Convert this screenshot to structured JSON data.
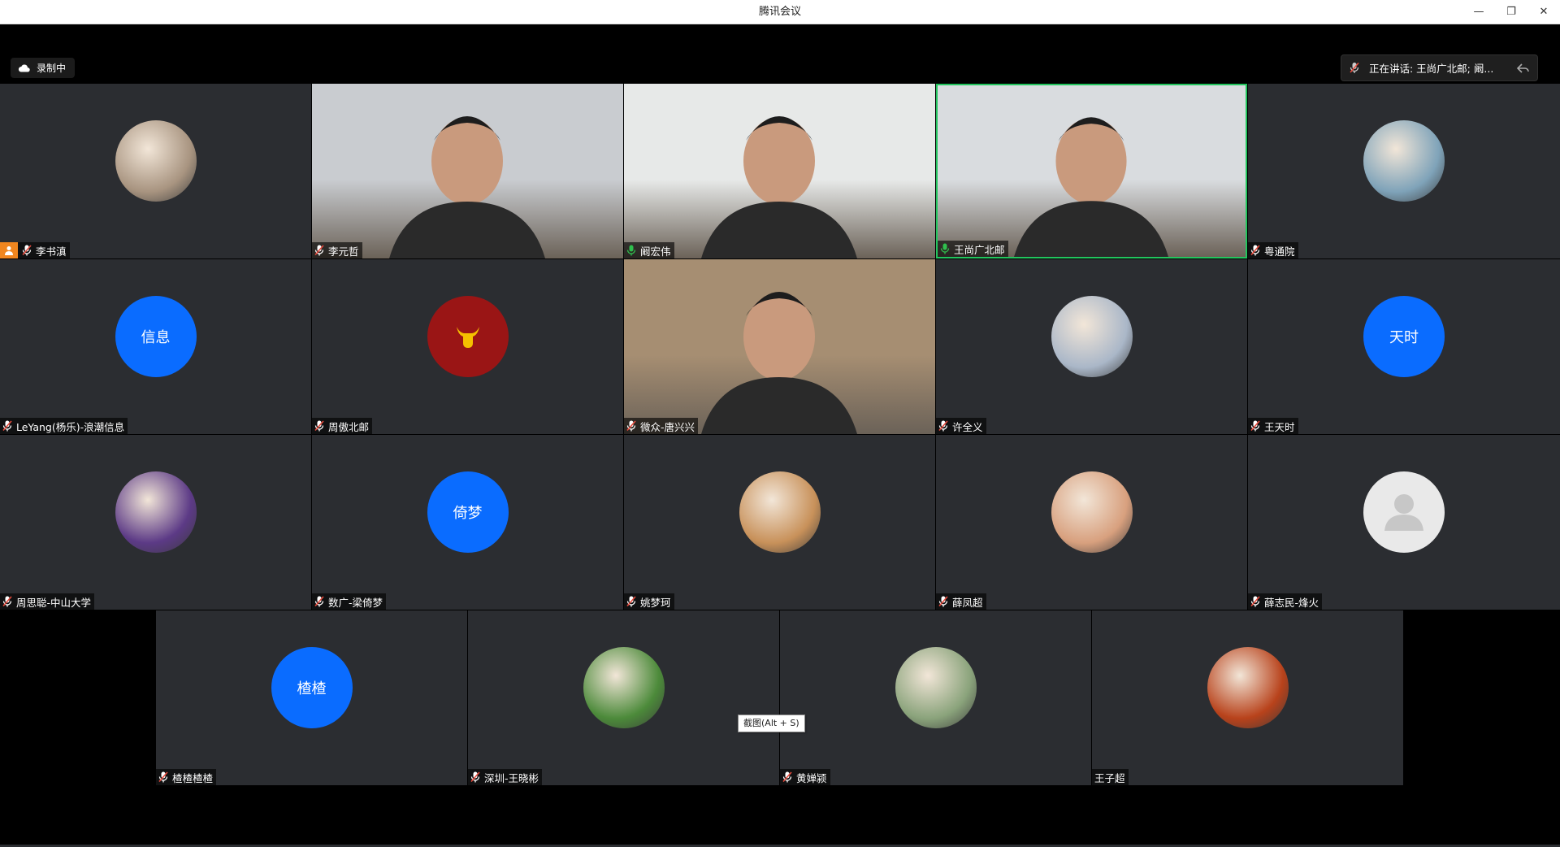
{
  "window": {
    "title": "腾讯会议",
    "minimize": "—",
    "restore": "❐",
    "close": "✕"
  },
  "recording": {
    "label": "录制中",
    "icon": "cloud-icon"
  },
  "speaking": {
    "label": "正在讲话: 王尚广北邮; 阚..."
  },
  "tooltip": "截图(Alt + S)",
  "colors": {
    "tile_bg": "#2b2d31",
    "accent_blue": "#0a6cff",
    "active_green": "#22c55e",
    "host_orange": "#f0861f",
    "mic_red": "#e64a3c",
    "mic_green": "#2fbf4d"
  },
  "participants": [
    {
      "name": "李书滇",
      "host": true,
      "type": "photo",
      "mic": "muted",
      "bg": "#a89480"
    },
    {
      "name": "李元哲",
      "type": "video",
      "mic": "muted",
      "bg": "#c9ccd0"
    },
    {
      "name": "阚宏伟",
      "type": "video",
      "mic": "speaking",
      "bg": "#e7e9e8"
    },
    {
      "name": "王尚广北邮",
      "type": "video",
      "mic": "speaking",
      "active": true,
      "bg": "#d9dcdf"
    },
    {
      "name": "粤通院",
      "type": "photo",
      "mic": "muted",
      "bg": "#7fa3b9"
    },
    {
      "name": "LeYang(杨乐)-浪潮信息",
      "type": "initials",
      "initials": "信息",
      "mic": "muted",
      "bg": "#0a6cff"
    },
    {
      "name": "周傲北邮",
      "type": "photo",
      "mic": "muted",
      "bg": "#9a1515",
      "icon": "ox-icon"
    },
    {
      "name": "微众-唐兴兴",
      "type": "video",
      "mic": "muted",
      "bg": "#a68e72"
    },
    {
      "name": "许全义",
      "type": "photo",
      "mic": "muted",
      "bg": "#aab7c8"
    },
    {
      "name": "王天时",
      "type": "initials",
      "initials": "天时",
      "mic": "muted",
      "bg": "#0a6cff"
    },
    {
      "name": "周思聪-中山大学",
      "type": "photo",
      "mic": "muted",
      "bg": "#5c3a86"
    },
    {
      "name": "数广-梁倚梦",
      "type": "initials",
      "initials": "倚梦",
      "mic": "muted",
      "bg": "#0a6cff"
    },
    {
      "name": "姚梦珂",
      "type": "photo",
      "mic": "muted",
      "bg": "#c8915a"
    },
    {
      "name": "薛凤超",
      "type": "photo",
      "mic": "muted",
      "bg": "#d8a07e"
    },
    {
      "name": "薛志民-烽火",
      "type": "default",
      "mic": "muted",
      "bg": "#e9e9e9",
      "icon": "user-icon"
    },
    {
      "name": "楂楂楂楂",
      "type": "initials",
      "initials": "楂楂",
      "mic": "muted",
      "bg": "#0a6cff"
    },
    {
      "name": "深圳-王晓彬",
      "type": "photo",
      "mic": "muted",
      "bg": "#4c8a3a"
    },
    {
      "name": "黄婵颍",
      "type": "photo",
      "mic": "muted",
      "bg": "#8aa37b"
    },
    {
      "name": "王子超",
      "type": "photo",
      "mic": "none",
      "bg": "#b8421b"
    }
  ]
}
